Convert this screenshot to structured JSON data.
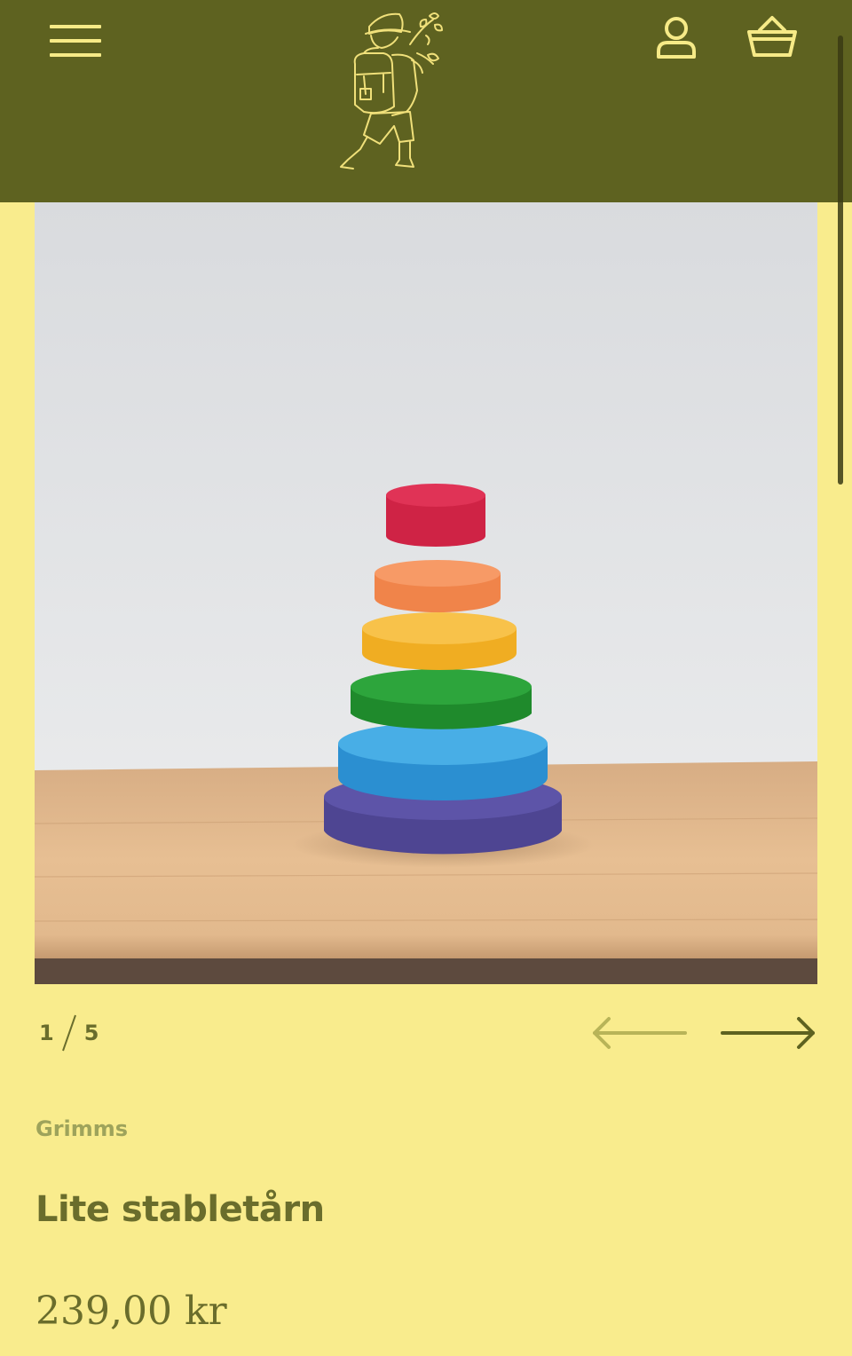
{
  "header": {
    "menu_icon": "hamburger-menu-icon",
    "logo": "hiker-with-backpack-and-flowers-logo",
    "account_icon": "user-account-icon",
    "cart_icon": "shopping-basket-icon",
    "background_color": "#5e6220",
    "icon_color": "#f6ea87"
  },
  "gallery": {
    "image": "rainbow-stacking-tower-photo",
    "current": "1",
    "total": "5",
    "prev_icon": "arrow-left-icon",
    "next_icon": "arrow-right-icon"
  },
  "product": {
    "brand": "Grimms",
    "title": "Lite stabletårn",
    "price": "239,00 kr"
  },
  "colors": {
    "page_background": "#f9ec8d",
    "text_primary": "#6a6d2c",
    "text_muted": "#9ea35b"
  }
}
